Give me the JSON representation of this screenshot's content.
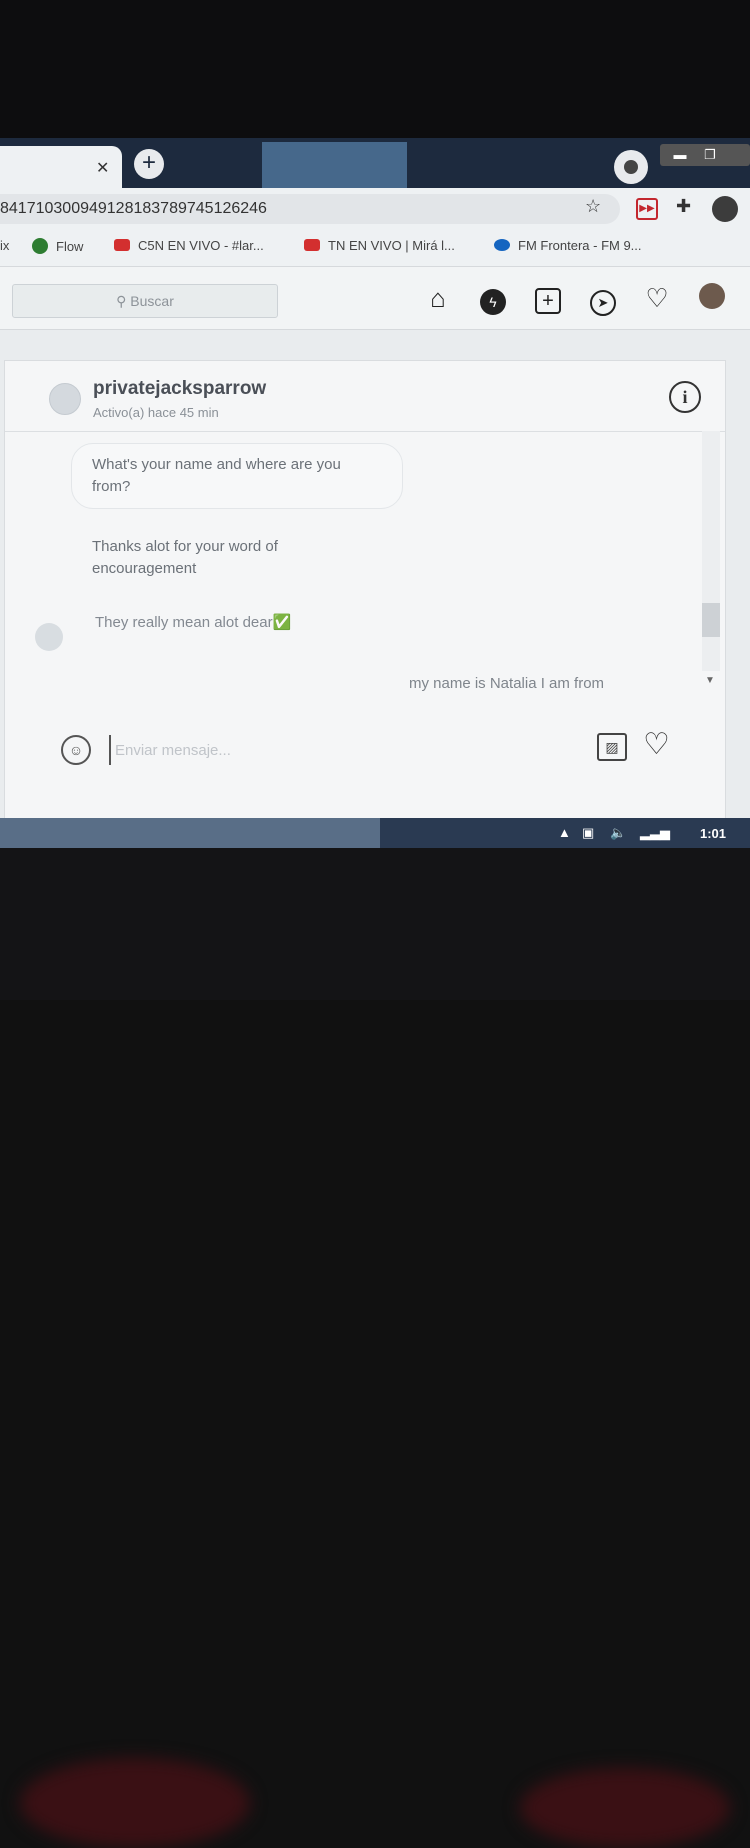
{
  "browser": {
    "tab_close": "✕",
    "new_tab": "+",
    "url": "84171030094912818378974512624​6",
    "bookmarks": [
      {
        "label": "ix",
        "color": ""
      },
      {
        "label": "Flow",
        "color": "#2e7d32"
      },
      {
        "label": "C5N EN VIVO - #lar...",
        "color": "#d32f2f"
      },
      {
        "label": "TN EN VIVO | Mirá l...",
        "color": "#d32f2f"
      },
      {
        "label": "FM Frontera - FM 9...",
        "color": "#1565c0"
      }
    ]
  },
  "instagram": {
    "search_placeholder": "Buscar",
    "chat": {
      "username": "privatejacksparrow",
      "status": "Activo(a) hace 45 min",
      "messages": [
        "What's your name and where are you from?",
        "Thanks alot for your word of encouragement",
        "They really mean alot dear✅"
      ],
      "outgoing": "my name is Natalia I am from",
      "input_placeholder": "Enviar mensaje..."
    }
  },
  "taskbar": {
    "clock": "1:01"
  },
  "colors": {
    "tab_strip": "#1d2a3e",
    "page_bg": "#f5f6f7",
    "text_primary": "#4a4f57"
  }
}
